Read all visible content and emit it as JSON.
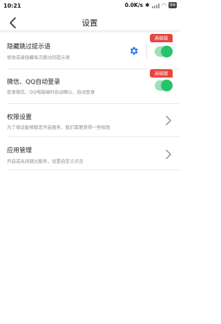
{
  "status_bar": {
    "time": "10:21",
    "network_speed": "0.0K/s",
    "bluetooth_icon": "bluetooth-icon",
    "battery": "99"
  },
  "header": {
    "title": "设置",
    "back_icon": "back-arrow-icon"
  },
  "settings": [
    {
      "title": "隐藏跳过提示语",
      "desc": "修改或者隐藏每次跳过的提示语",
      "badge": "高级版",
      "control": "toggle",
      "enabled": true,
      "extra_icon": "gear-icon"
    },
    {
      "title": "微信、QQ自动登录",
      "desc": "登录微信、QQ电脑端时自动确认，自动登录",
      "badge": "高级版",
      "control": "toggle",
      "enabled": true
    },
    {
      "title": "权限设置",
      "desc": "为了保证能够稳定开启服务，我们需要获得一些权限",
      "control": "chevron"
    },
    {
      "title": "应用管理",
      "desc": "开启或关闭跳过服务，设置自定义点击",
      "control": "chevron"
    }
  ],
  "colors": {
    "accent_green": "#27c36b",
    "badge_red": "#e8453c",
    "gear_blue": "#2b7de9"
  }
}
